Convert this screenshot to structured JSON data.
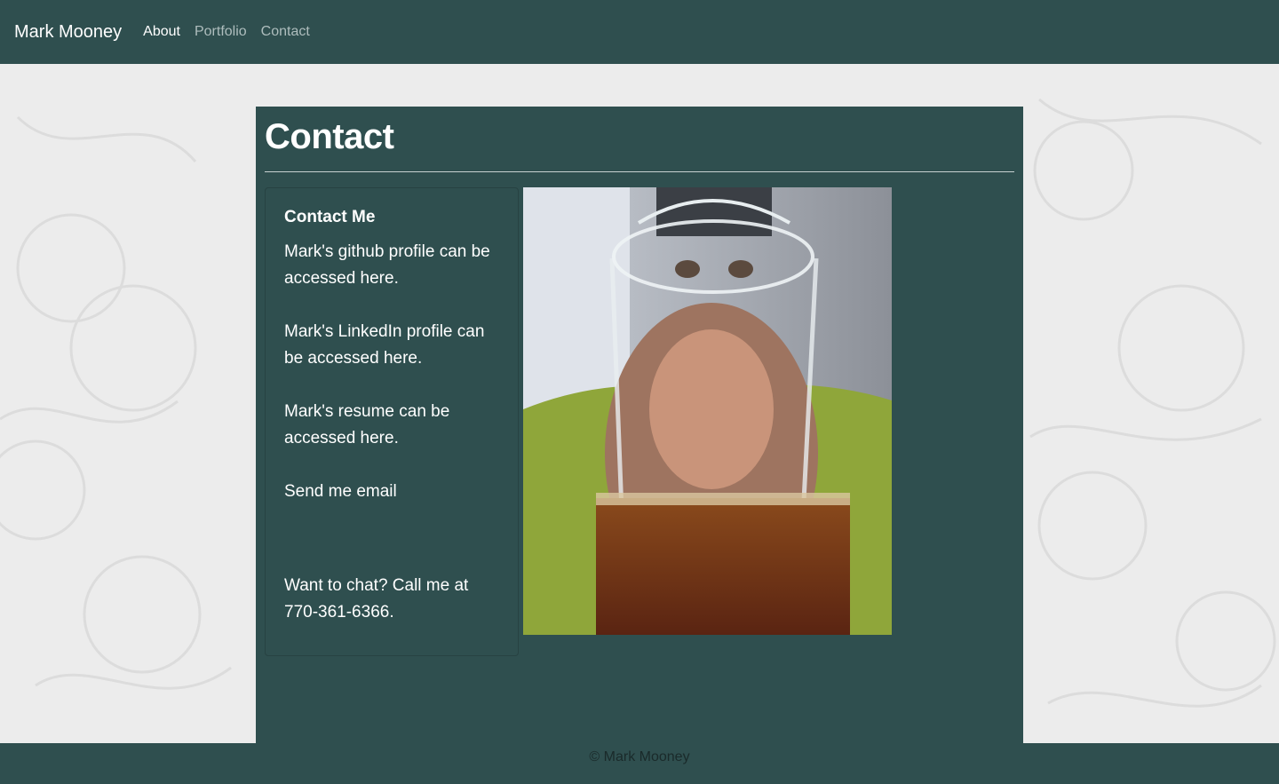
{
  "navbar": {
    "brand": "Mark Mooney",
    "links": [
      "About",
      "Portfolio",
      "Contact"
    ]
  },
  "page": {
    "title": "Contact"
  },
  "contact_card": {
    "title": "Contact Me",
    "github_text": "Mark's github profile can be accessed here.",
    "linkedin_text": "Mark's LinkedIn profile can be accessed here.",
    "resume_text": "Mark's resume can be accessed here.",
    "email_text": "Send me email",
    "phone_text": "Want to chat? Call me at 770-361-6366."
  },
  "footer": {
    "copyright": "© Mark Mooney"
  },
  "colors": {
    "header_bg": "#2f4f4f",
    "panel_bg": "#2f4f4f",
    "page_bg": "#ececec",
    "text": "#ffffff",
    "nav_inactive": "#aebdbd"
  },
  "icons": [
    "bear-pattern-background"
  ]
}
